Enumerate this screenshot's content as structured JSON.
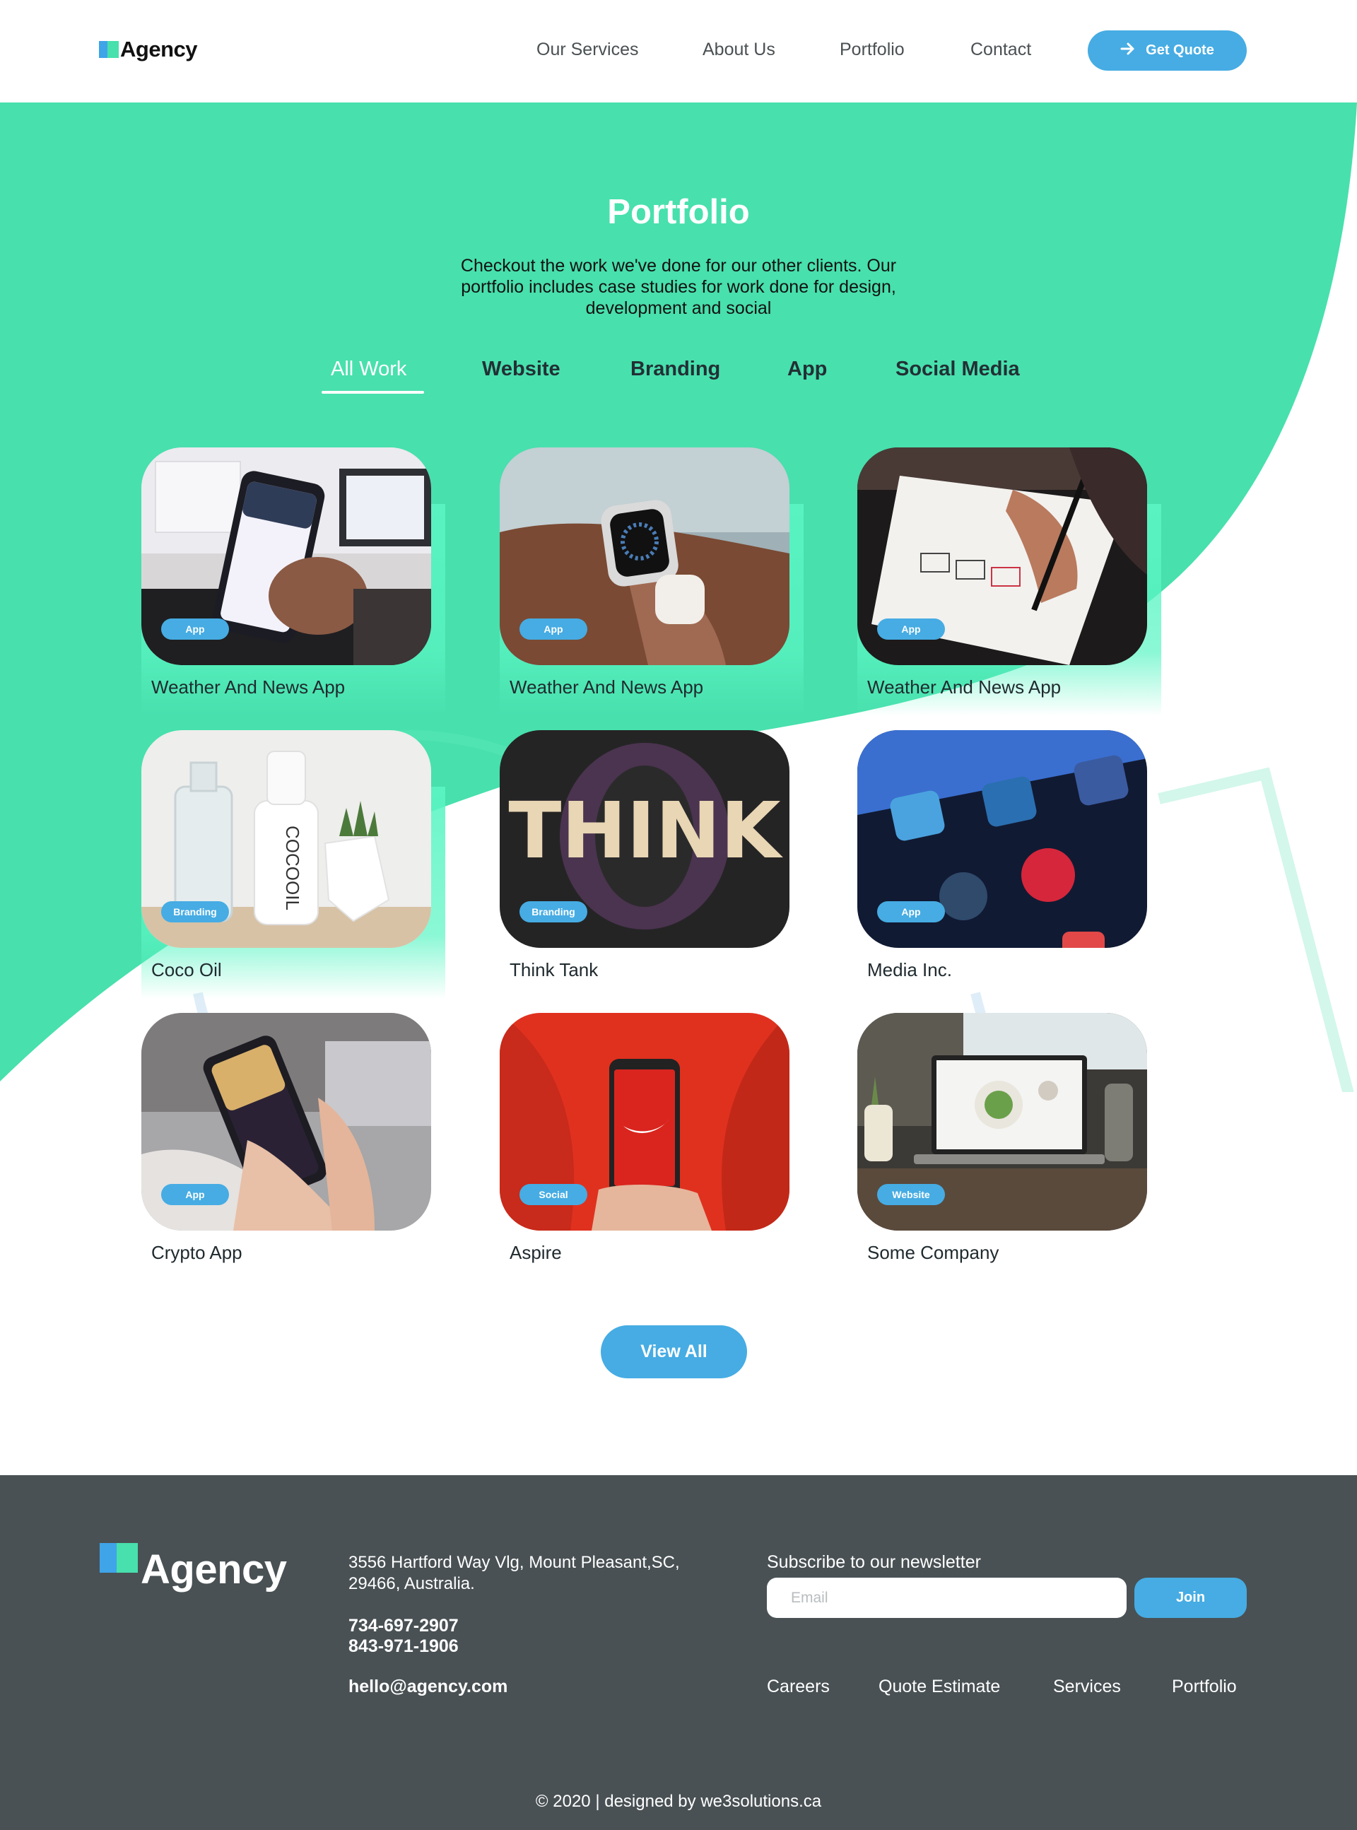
{
  "brand": {
    "name": "Agency"
  },
  "header": {
    "nav": [
      "Our Services",
      "About Us",
      "Portfolio",
      "Contact"
    ],
    "cta": "Get Quote"
  },
  "hero": {
    "title": "Portfolio",
    "subtitle": "Checkout the work we've done for our other clients. Our portfolio includes case studies for work done for design, development and social"
  },
  "filters": {
    "items": [
      "All Work",
      "Website",
      "Branding",
      "App",
      "Social Media"
    ],
    "active": "All Work"
  },
  "projects": [
    {
      "title": "Weather And News App",
      "tag": "App",
      "image": "phone-weather-app-photo"
    },
    {
      "title": "Weather And News App",
      "tag": "App",
      "image": "smartwatch-photo"
    },
    {
      "title": "Weather And News App",
      "tag": "App",
      "image": "hand-sketching-wireframe-photo"
    },
    {
      "title": "Coco Oil",
      "tag": "Branding",
      "image": "cocooil-bottle-photo"
    },
    {
      "title": "Think Tank",
      "tag": "Branding",
      "image": "think-letters-photo"
    },
    {
      "title": "Media Inc.",
      "tag": "App",
      "image": "social-media-icons-photo"
    },
    {
      "title": "Crypto App",
      "tag": "App",
      "image": "hands-holding-phone-photo"
    },
    {
      "title": "Aspire",
      "tag": "Social",
      "image": "red-phone-nike-photo"
    },
    {
      "title": "Some Company",
      "tag": "Website",
      "image": "laptop-food-website-photo"
    }
  ],
  "view_all": "View All",
  "footer": {
    "brand": "Agency",
    "address": "3556 Hartford Way Vlg, Mount Pleasant,SC, 29466, Australia.",
    "phones": [
      "734-697-2907",
      "843-971-1906"
    ],
    "email": "hello@agency.com",
    "newsletter_label": "Subscribe to our newsletter",
    "email_placeholder": "Email",
    "join": "Join",
    "links": [
      "Careers",
      "Quote Estimate",
      "Services",
      "Portfolio"
    ],
    "socials": [
      "facebook-icon",
      "instagram-icon",
      "twitter-icon"
    ],
    "copyright": "© 2020 | designed by we3solutions.ca"
  },
  "colors": {
    "green": "#48e0ad",
    "blue": "#46ace3",
    "footer": "#495154"
  }
}
